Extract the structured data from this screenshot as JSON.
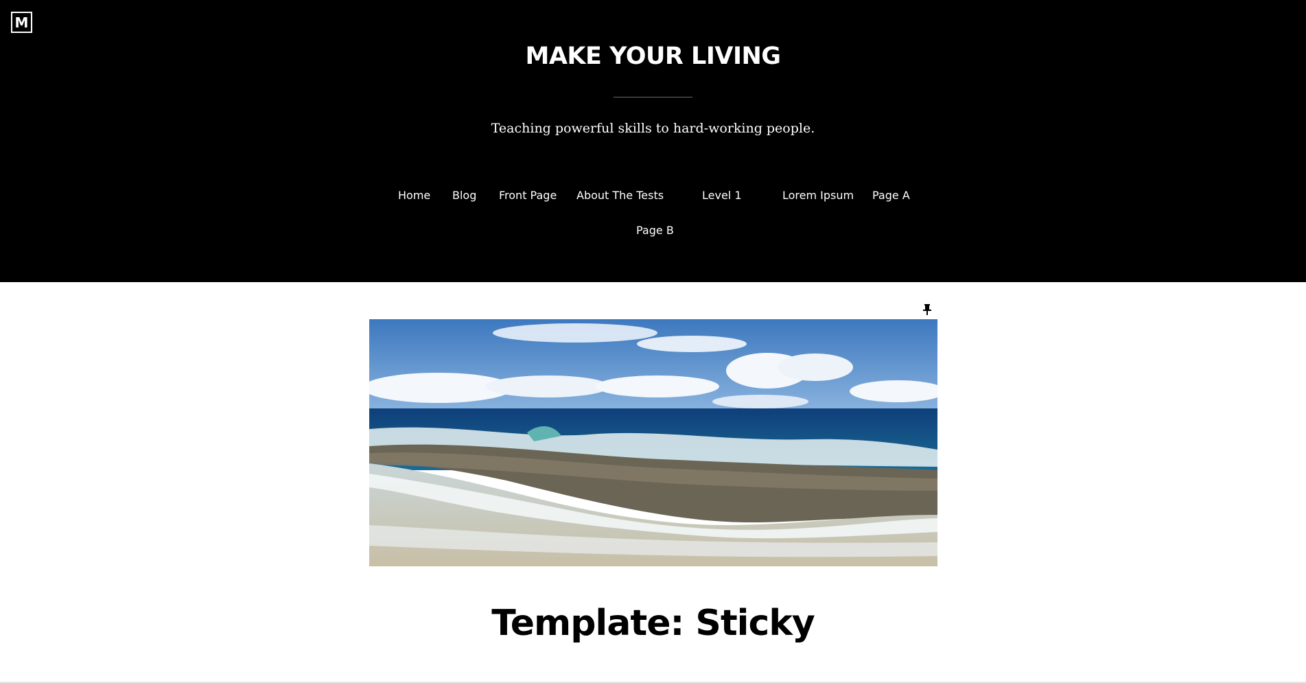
{
  "header": {
    "logo_letter": "M",
    "site_title": "MAKE YOUR LIVING",
    "tagline": "Teaching powerful skills to hard-working people.",
    "background_color": "#000000"
  },
  "nav": {
    "items": [
      {
        "label": "Home"
      },
      {
        "label": "Blog"
      },
      {
        "label": "Front Page"
      },
      {
        "label": "About The Tests"
      },
      {
        "label": "Level 1"
      },
      {
        "label": "Lorem Ipsum"
      },
      {
        "label": "Page A"
      },
      {
        "label": "Page B"
      }
    ]
  },
  "post": {
    "sticky_icon": "pushpin-icon",
    "featured_image": "ocean-waves-rocky-shore-photo",
    "title": "Template: Sticky"
  }
}
